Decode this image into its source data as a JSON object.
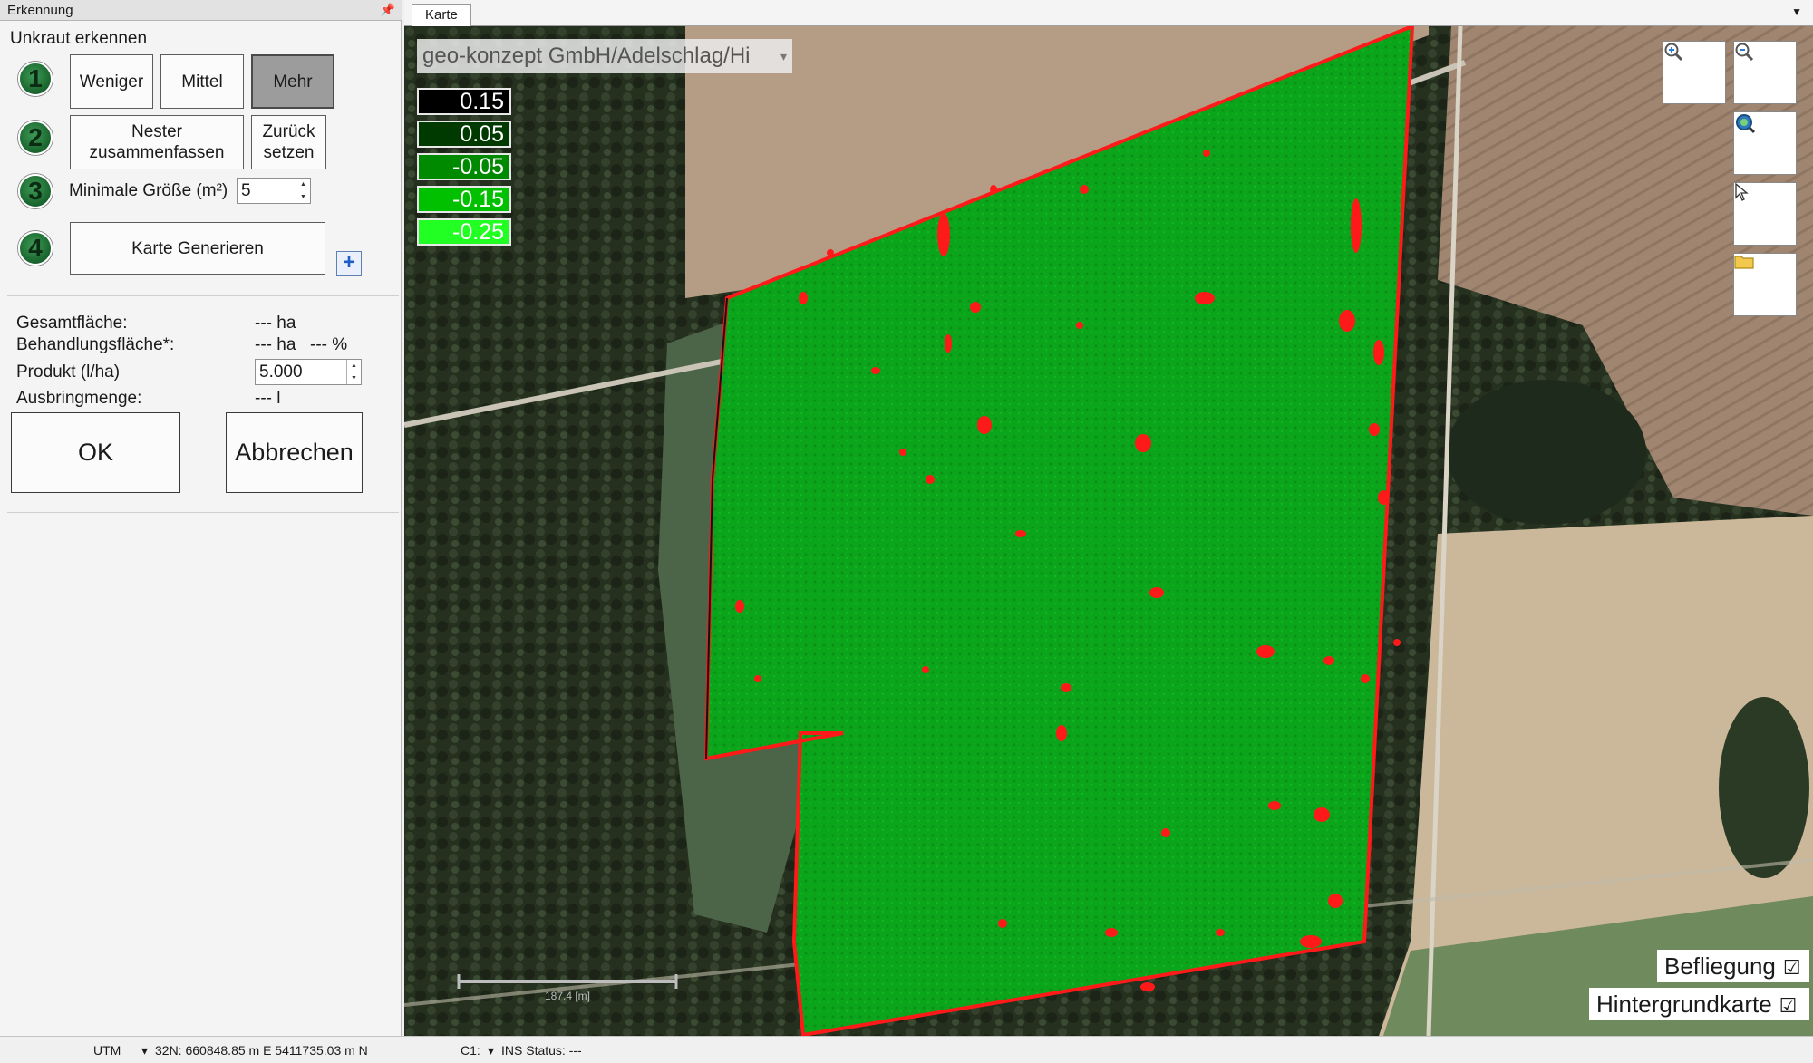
{
  "panel": {
    "title": "Erkennung",
    "pin_icon": "📌",
    "section_title": "Unkraut erkennen",
    "step1": {
      "number": "1",
      "buttons": [
        "Weniger",
        "Mittel",
        "Mehr"
      ],
      "selected": "Mehr"
    },
    "step2": {
      "number": "2",
      "merge_label": "Nester zusammenfassen",
      "reset_label": "Zurück setzen"
    },
    "step3": {
      "number": "3",
      "min_size_label": "Minimale Größe (m²)",
      "min_size_value": "5"
    },
    "step4": {
      "number": "4",
      "generate_label": "Karte Generieren",
      "plus": "+"
    },
    "stats": {
      "total_area_label": "Gesamtfläche:",
      "total_area_value": "--- ha",
      "treat_area_label": "Behandlungsfläche*:",
      "treat_area_value": "--- ha",
      "treat_area_pct": "--- %",
      "product_label": "Produkt (l/ha)",
      "product_value": "5.000",
      "amount_label": "Ausbringmenge:",
      "amount_value": "--- l"
    },
    "ok_label": "OK",
    "cancel_label": "Abbrechen"
  },
  "map": {
    "tab_label": "Karte",
    "source": "geo-konzept GmbH/Adelschlag/Hi",
    "legend": [
      {
        "value": "0.15",
        "color": "#000000"
      },
      {
        "value": "0.05",
        "color": "#003a00"
      },
      {
        "value": "-0.05",
        "color": "#008a00"
      },
      {
        "value": "-0.15",
        "color": "#00c000"
      },
      {
        "value": "-0.25",
        "color": "#22ff22"
      }
    ],
    "tools": [
      "zoom-in-icon",
      "zoom-out-icon",
      "zoom-extent-icon",
      "select-cursor-icon",
      "folder-icon"
    ],
    "scale_label": "187.4 [m]",
    "layers": [
      {
        "label": "Befliegung",
        "checked": true
      },
      {
        "label": "Hintergrundkarte",
        "checked": true
      }
    ],
    "colors": {
      "field_green": "#0aa51a",
      "weed_red": "#ff1a1a",
      "forest": "#1f2a1c"
    }
  },
  "status": {
    "crs": "UTM",
    "coords": "32N: 660848.85 m E 5411735.03 m N",
    "channel": "C1:",
    "ins_status": "INS Status: ---"
  }
}
